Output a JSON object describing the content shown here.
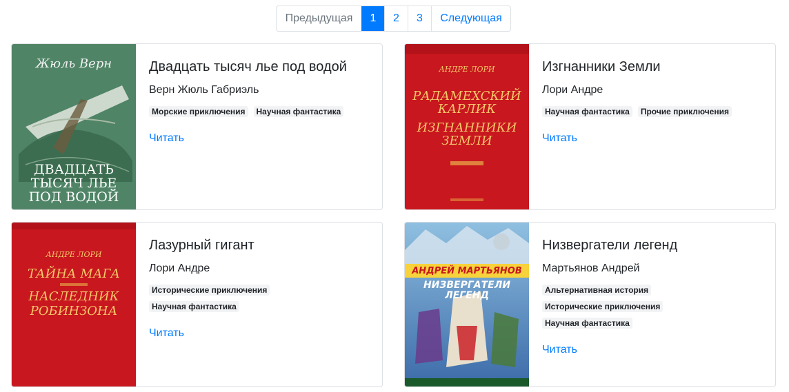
{
  "pagination": {
    "prev": "Предыдущая",
    "pages": [
      "1",
      "2",
      "3"
    ],
    "active": "1",
    "next": "Следующая"
  },
  "books": [
    {
      "title": "Двадцать тысяч лье под водой",
      "author": "Верн Жюль Габриэль",
      "tags": [
        "Морские приключения",
        "Научная фантастика"
      ],
      "read_label": "Читать",
      "cover": {
        "color": "#4f8466",
        "author": "Жюль Верн",
        "title_lines": [
          "ДВАДЦАТЬ",
          "ТЫСЯЧ ЛЬЕ",
          "ПОД ВОДОЙ"
        ]
      }
    },
    {
      "title": "Изгнанники Земли",
      "author": "Лори Андре",
      "tags": [
        "Научная фантастика",
        "Прочие приключения"
      ],
      "read_label": "Читать",
      "cover": {
        "color": "#c8171e",
        "author": "АНДРЕ ЛОРИ",
        "title_lines": [
          "РАДАМЕХСКИЙ",
          "КАРЛИК",
          "ИЗГНАННИКИ",
          "ЗЕМЛИ"
        ]
      }
    },
    {
      "title": "Лазурный гигант",
      "author": "Лори Андре",
      "tags": [
        "Исторические приключения",
        "Научная фантастика"
      ],
      "read_label": "Читать",
      "cover": {
        "color": "#c8171e",
        "author": "АНДРЕ ЛОРИ",
        "title_lines": [
          "ТАЙНА МАГА",
          "НАСЛЕДНИК",
          "РОБИНЗОНА"
        ]
      }
    },
    {
      "title": "Низвергатели легенд",
      "author": "Мартьянов Андрей",
      "tags": [
        "Альтернативная история",
        "Исторические приключения",
        "Научная фантастика"
      ],
      "read_label": "Читать",
      "cover": {
        "color": "#3b6aa8",
        "author": "АНДРЕЙ МАРТЬЯНОВ",
        "title_lines": [
          "НИЗВЕРГАТЕЛИ",
          "ЛЕГЕНД"
        ]
      }
    }
  ]
}
